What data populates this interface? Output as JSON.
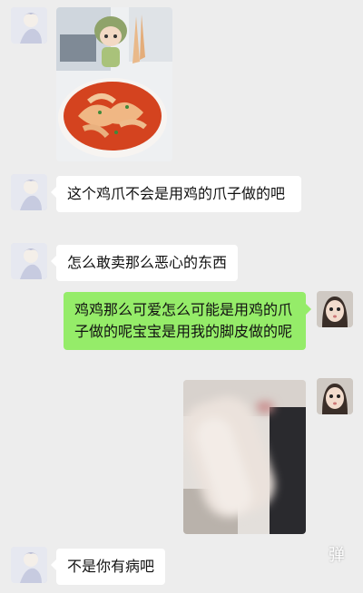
{
  "messages": [
    {
      "id": "m1",
      "side": "left",
      "kind": "image",
      "image": "food-photo"
    },
    {
      "id": "m2",
      "side": "left",
      "kind": "text",
      "text": "这个鸡爪不会是用鸡的爪子做的吧"
    },
    {
      "id": "m3",
      "side": "left",
      "kind": "text",
      "text": "怎么敢卖那么恶心的东西"
    },
    {
      "id": "m4",
      "side": "right",
      "kind": "text",
      "text": "鸡鸡那么可爱怎么可能是用鸡的爪子做的呢宝宝是用我的脚皮做的呢"
    },
    {
      "id": "m5",
      "side": "right",
      "kind": "image",
      "image": "blurred-photo"
    },
    {
      "id": "m6",
      "side": "left",
      "kind": "text",
      "text": "不是你有病吧"
    }
  ],
  "colors": {
    "background": "#ededed",
    "received_bubble": "#ffffff",
    "sent_bubble": "#95ec69"
  },
  "overlay": {
    "danmu_label": "弹"
  }
}
